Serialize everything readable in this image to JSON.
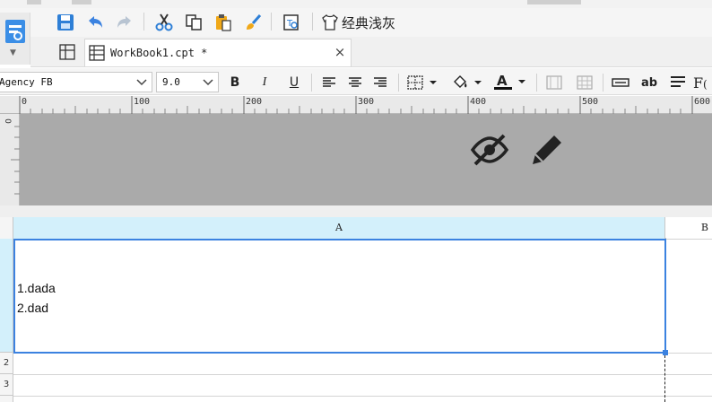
{
  "toolbar": {
    "style_label": "经典浅灰"
  },
  "tab": {
    "label": "WorkBook1.cpt *",
    "close": "×"
  },
  "format": {
    "font_value": "Agency FB",
    "size_value": "9.0",
    "bold": "B",
    "italic": "I",
    "underline": "U",
    "ab": "ab"
  },
  "ruler": {
    "marks": [
      "0",
      "100",
      "200",
      "300",
      "400",
      "500",
      "600"
    ],
    "vertical_mark": "0"
  },
  "sheet": {
    "col_a": "A",
    "col_b": "B",
    "row_2": "2",
    "row_3": "3",
    "cell_a1_lines": [
      "1.dada",
      "2.dad"
    ]
  },
  "colors": {
    "accent": "#3b82e0",
    "header_selected": "#d3f0fb",
    "canvas": "#aaaaaa"
  }
}
